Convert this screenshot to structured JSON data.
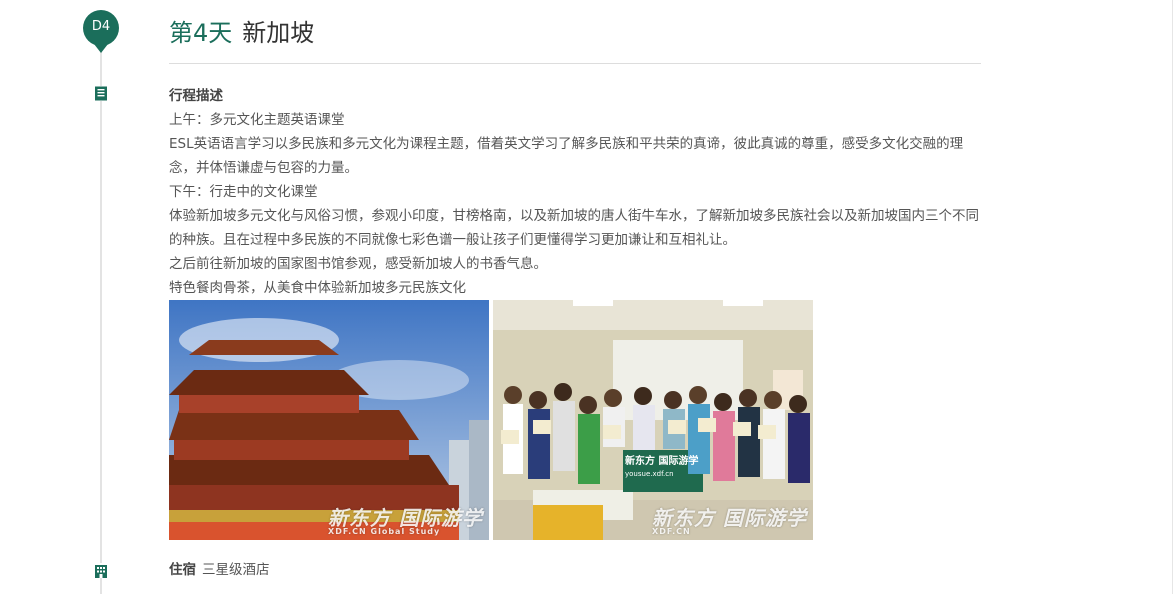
{
  "day": {
    "badge": "D4",
    "title_day": "第4天",
    "title_city": "新加坡"
  },
  "itinerary": {
    "heading": "行程描述",
    "lines": [
      "上午：多元文化主题英语课堂",
      "ESL英语语言学习以多民族和多元文化为课程主题，借着英文学习了解多民族和平共荣的真谛，彼此真诚的尊重，感受多文化交融的理念，并体悟谦虚与包容的力量。",
      "下午：行走中的文化课堂",
      "体验新加坡多元文化与风俗习惯，参观小印度，甘榜格南，以及新加坡的唐人街牛车水，了解新加坡多民族社会以及新加坡国内三个不同的种族。且在过程中多民族的不同就像七彩色谱一般让孩子们更懂得学习更加谦让和互相礼让。",
      "之后前往新加坡的国家图书馆参观，感受新加坡人的书香气息。",
      "特色餐肉骨茶，从美食中体验新加坡多元民族文化"
    ]
  },
  "photos": [
    {
      "name": "temple-photo",
      "watermark": "新东方 国际游学",
      "watermark_sub": "XDF.CN   Global Study"
    },
    {
      "name": "class-photo",
      "watermark": "新东方 国际游学",
      "watermark_sub": "XDF.CN",
      "banner": "新东方 国际游学",
      "banner_sub": "yousue.xdf.cn"
    }
  ],
  "accommodation": {
    "label": "住宿",
    "value": "三星级酒店"
  },
  "colors": {
    "accent": "#1b6e5b",
    "text": "#555555",
    "divider": "#dddddd"
  },
  "icons": {
    "itinerary": "document-list-icon",
    "accommodation": "building-icon"
  }
}
